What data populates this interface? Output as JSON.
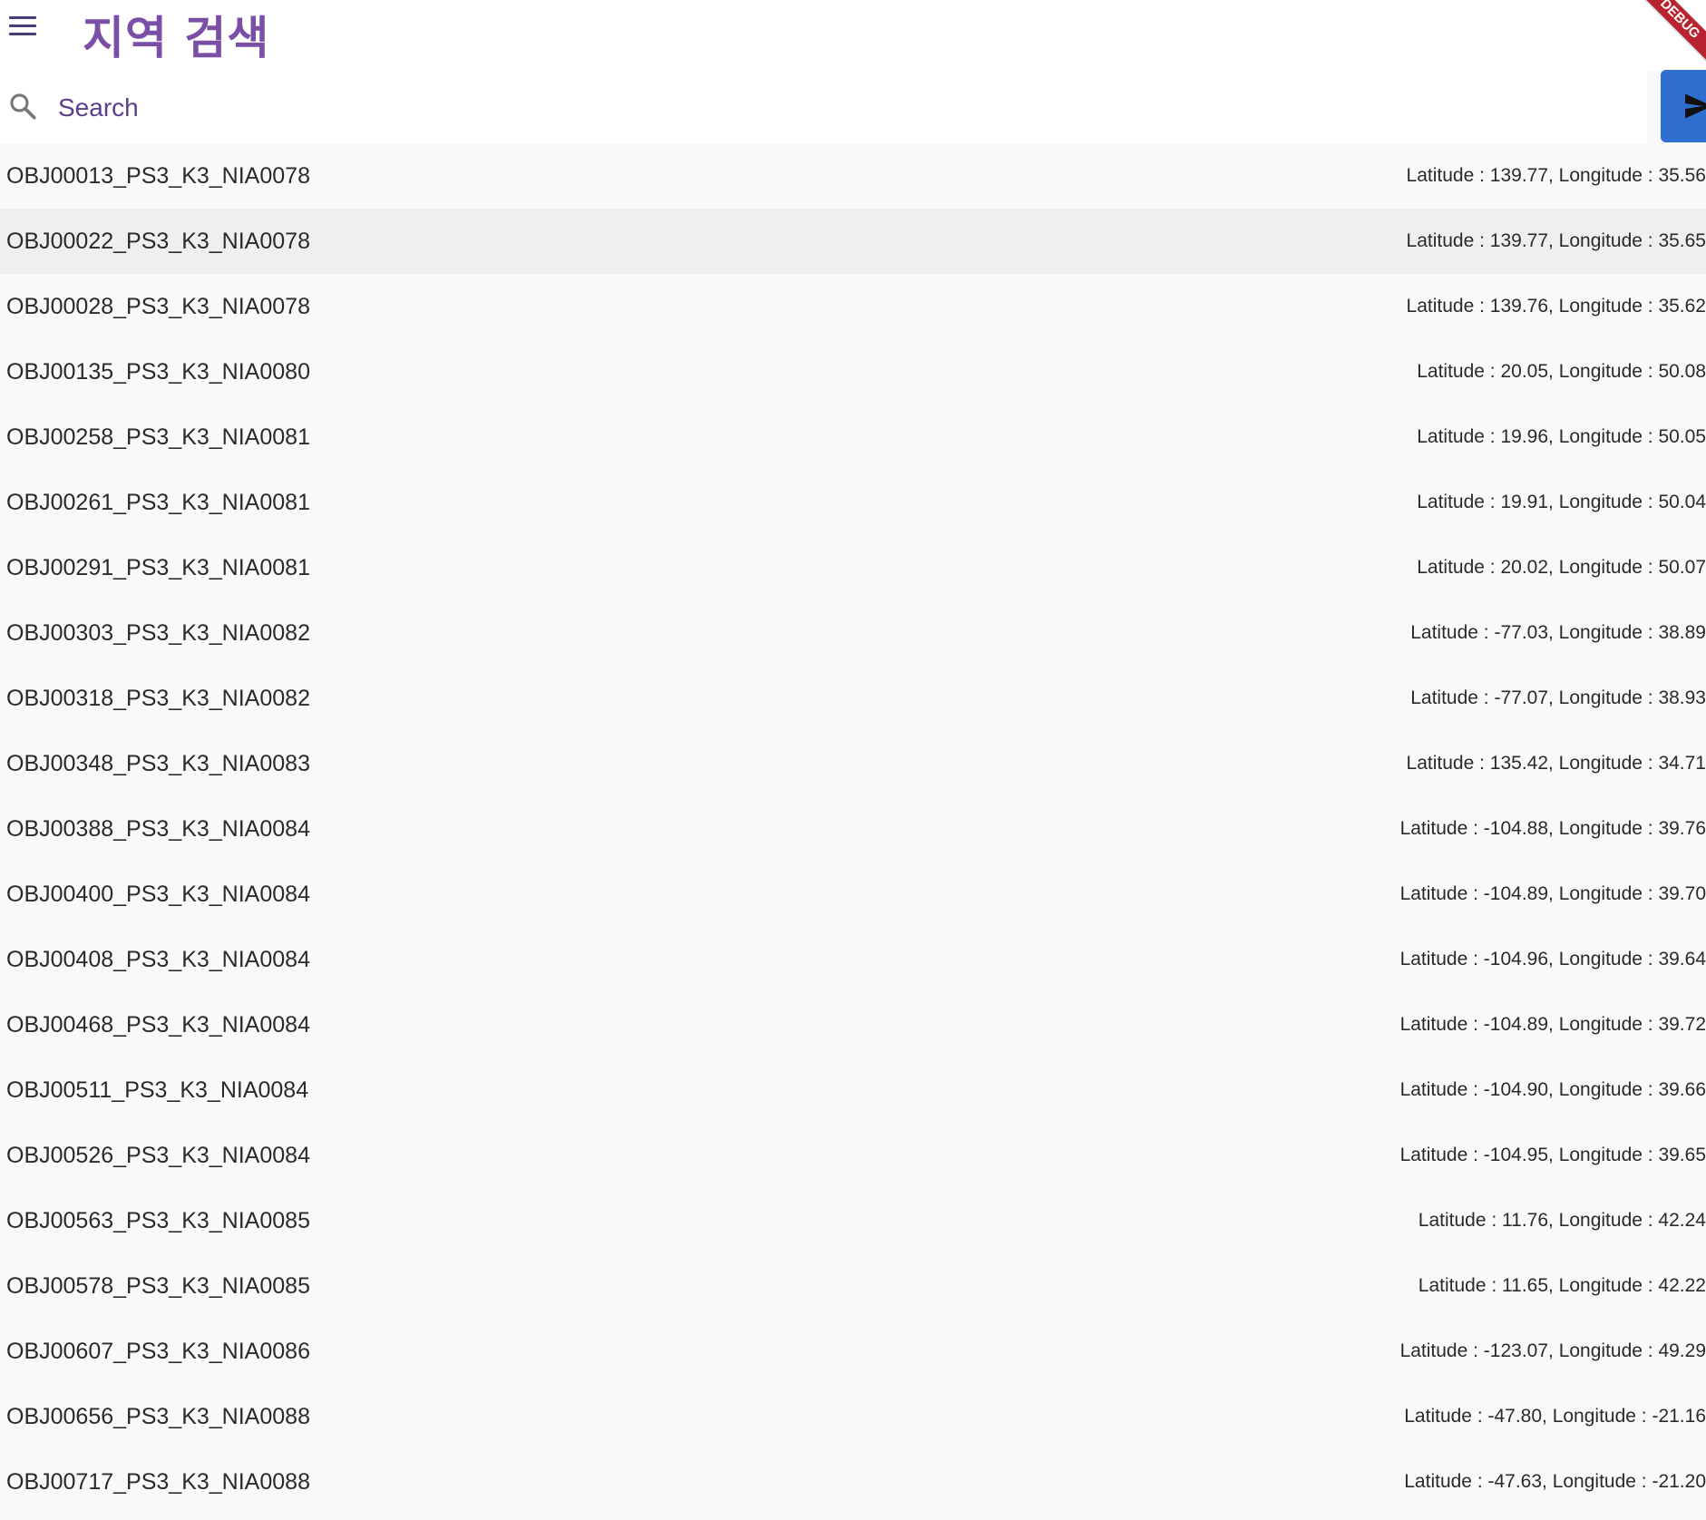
{
  "header": {
    "title": "지역 검색",
    "debug_banner": "DEBUG"
  },
  "search": {
    "placeholder": "Search",
    "value": ""
  },
  "icons": {
    "menu": "menu-icon",
    "search": "search-icon",
    "send": "send-icon"
  },
  "colors": {
    "title": "#7b4fa6",
    "send_button": "#2f6fcf",
    "debug_banner": "#b8232f"
  },
  "results": [
    {
      "name": "OBJ00013_PS3_K3_NIA0078",
      "coords": "Latitude : 139.77, Longitude : 35.56"
    },
    {
      "name": "OBJ00022_PS3_K3_NIA0078",
      "coords": "Latitude : 139.77, Longitude : 35.65"
    },
    {
      "name": "OBJ00028_PS3_K3_NIA0078",
      "coords": "Latitude : 139.76, Longitude : 35.62"
    },
    {
      "name": "OBJ00135_PS3_K3_NIA0080",
      "coords": "Latitude : 20.05, Longitude : 50.08"
    },
    {
      "name": "OBJ00258_PS3_K3_NIA0081",
      "coords": "Latitude : 19.96, Longitude : 50.05"
    },
    {
      "name": "OBJ00261_PS3_K3_NIA0081",
      "coords": "Latitude : 19.91, Longitude : 50.04"
    },
    {
      "name": "OBJ00291_PS3_K3_NIA0081",
      "coords": "Latitude : 20.02, Longitude : 50.07"
    },
    {
      "name": "OBJ00303_PS3_K3_NIA0082",
      "coords": "Latitude : -77.03, Longitude : 38.89"
    },
    {
      "name": "OBJ00318_PS3_K3_NIA0082",
      "coords": "Latitude : -77.07, Longitude : 38.93"
    },
    {
      "name": "OBJ00348_PS3_K3_NIA0083",
      "coords": "Latitude : 135.42, Longitude : 34.71"
    },
    {
      "name": "OBJ00388_PS3_K3_NIA0084",
      "coords": "Latitude : -104.88, Longitude : 39.76"
    },
    {
      "name": "OBJ00400_PS3_K3_NIA0084",
      "coords": "Latitude : -104.89, Longitude : 39.70"
    },
    {
      "name": "OBJ00408_PS3_K3_NIA0084",
      "coords": "Latitude : -104.96, Longitude : 39.64"
    },
    {
      "name": "OBJ00468_PS3_K3_NIA0084",
      "coords": "Latitude : -104.89, Longitude : 39.72"
    },
    {
      "name": "OBJ00511_PS3_K3_NIA0084",
      "coords": "Latitude : -104.90, Longitude : 39.66"
    },
    {
      "name": "OBJ00526_PS3_K3_NIA0084",
      "coords": "Latitude : -104.95, Longitude : 39.65"
    },
    {
      "name": "OBJ00563_PS3_K3_NIA0085",
      "coords": "Latitude : 11.76, Longitude : 42.24"
    },
    {
      "name": "OBJ00578_PS3_K3_NIA0085",
      "coords": "Latitude : 11.65, Longitude : 42.22"
    },
    {
      "name": "OBJ00607_PS3_K3_NIA0086",
      "coords": "Latitude : -123.07, Longitude : 49.29"
    },
    {
      "name": "OBJ00656_PS3_K3_NIA0088",
      "coords": "Latitude : -47.80, Longitude : -21.16"
    },
    {
      "name": "OBJ00717_PS3_K3_NIA0088",
      "coords": "Latitude : -47.63, Longitude : -21.20"
    }
  ]
}
